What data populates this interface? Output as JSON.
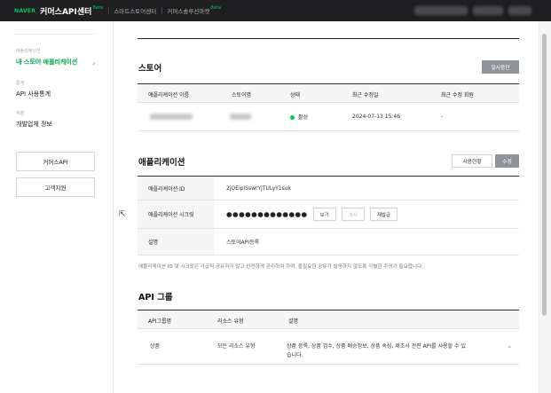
{
  "header": {
    "naver": "NAVER",
    "brand": "커머스API센터",
    "beta": "Beta",
    "sep": "|",
    "link1": "스마트스토어센터",
    "link2": "커머스솔루션마켓",
    "link2_beta": "Beta"
  },
  "sidebar": {
    "groups": [
      {
        "caption": "애플리케이션",
        "item": "내 스토어 애플리케이션"
      },
      {
        "caption": "통계",
        "item": "API 사용통계"
      },
      {
        "caption": "계정",
        "item": "개발업체 정보"
      }
    ],
    "buttons": [
      "커머스API",
      "고객지원"
    ]
  },
  "store": {
    "title": "스토어",
    "suspend_label": "일시중단",
    "headers": [
      "애플리케이션 이름",
      "스토어명",
      "상태",
      "최근 수정일",
      "최근 수정 회원"
    ],
    "row": {
      "status": "활성",
      "modified": "2024-07-13 15:46",
      "modified_by": "-"
    }
  },
  "app": {
    "title": "애플리케이션",
    "history_label": "사용현황",
    "edit_label": "수정",
    "id_label": "애플리케이션 ID",
    "id_value": "2jOEipiSswrYjTULyY1suk",
    "secret_label": "애플리케이션 시크릿",
    "secret_value": "●●●●●●●●●●●●●",
    "view_label": "보기",
    "copy_label": "복사",
    "reissue_label": "재발급",
    "desc_label": "설명",
    "desc_value": "스토어API등록",
    "notice": "애플리케이션 ID 및 시크릿은 가급적 공유하지 않고 안전하게 관리하여 하며, 불필요한 공유가 발생하지 않도록 각별한 주의가 필요합니다."
  },
  "api_group": {
    "title": "API 그룹",
    "headers": [
      "API그룹명",
      "리소스 유형",
      "설명"
    ],
    "row": {
      "name": "상품",
      "resource": "모든 리소스 유형",
      "desc_line1": "상품 등록, 상품 검수, 상품 배송정보, 상품 속성, 제조사 관련 API를 사용할 수 있",
      "desc_line2": "습니다."
    }
  },
  "colors": {
    "accent": "#03c75a",
    "topbar": "#1f1f21"
  }
}
